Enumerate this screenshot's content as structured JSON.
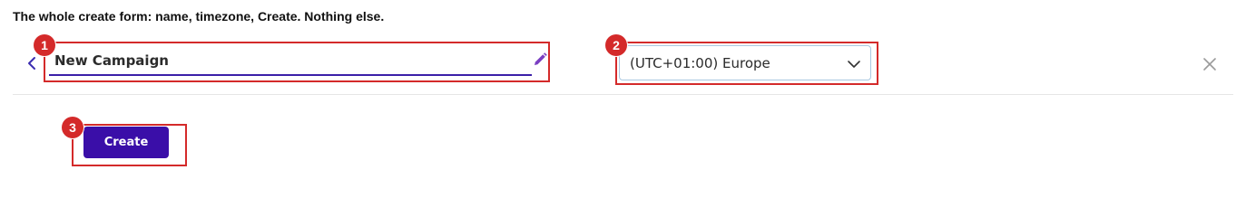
{
  "caption": "The whole create form: name, timezone, Create. Nothing else.",
  "form": {
    "name_value": "New Campaign",
    "timezone_value": "(UTC+01:00) Europe",
    "create_label": "Create"
  },
  "icons": {
    "back": "chevron-left-icon",
    "edit": "pencil-icon",
    "dropdown": "chevron-down-icon",
    "close": "close-icon"
  },
  "annotations": {
    "markers": [
      "1",
      "2",
      "3"
    ],
    "color": "#d42a2a"
  },
  "colors": {
    "accent": "#3a0ea8",
    "underline": "#3b1fa8",
    "edit_icon": "#7a3fc2"
  }
}
